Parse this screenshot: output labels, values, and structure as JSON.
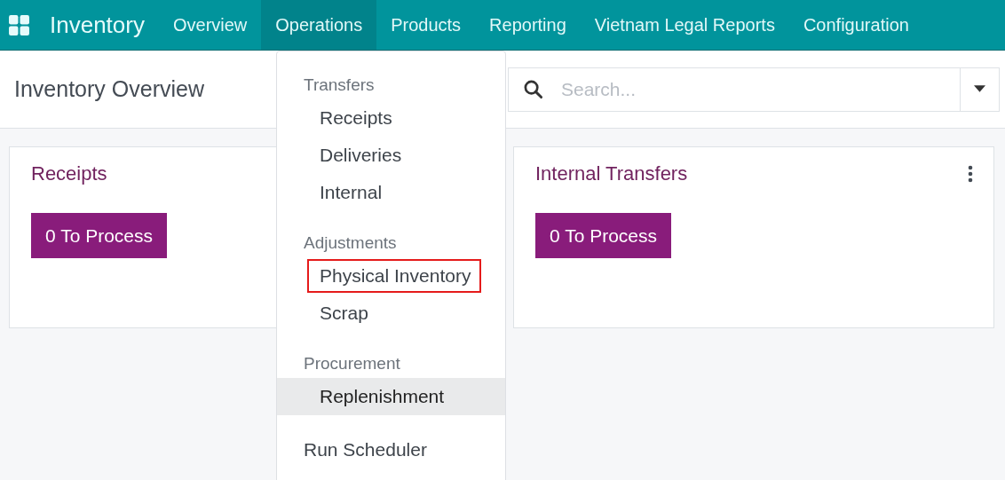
{
  "navbar": {
    "app_name": "Inventory",
    "items": [
      {
        "label": "Overview",
        "selected": false
      },
      {
        "label": "Operations",
        "selected": true
      },
      {
        "label": "Products",
        "selected": false
      },
      {
        "label": "Reporting",
        "selected": false
      },
      {
        "label": "Vietnam Legal Reports",
        "selected": false
      },
      {
        "label": "Configuration",
        "selected": false
      }
    ]
  },
  "page_title": "Inventory Overview",
  "search": {
    "placeholder": "Search..."
  },
  "cards": [
    {
      "title": "Receipts",
      "button": "0 To Process"
    },
    {
      "title": "Internal Transfers",
      "button": "0 To Process",
      "has_menu": true
    }
  ],
  "operations_menu": [
    {
      "kind": "header",
      "label": "Transfers"
    },
    {
      "kind": "sub",
      "label": "Receipts",
      "highlighted": false,
      "outlined": false
    },
    {
      "kind": "sub",
      "label": "Deliveries",
      "highlighted": false,
      "outlined": false
    },
    {
      "kind": "sub",
      "label": "Internal",
      "highlighted": false,
      "outlined": false
    },
    {
      "kind": "header",
      "label": "Adjustments"
    },
    {
      "kind": "sub",
      "label": "Physical Inventory",
      "highlighted": false,
      "outlined": true
    },
    {
      "kind": "sub",
      "label": "Scrap",
      "highlighted": false,
      "outlined": false
    },
    {
      "kind": "header",
      "label": "Procurement"
    },
    {
      "kind": "sub",
      "label": "Replenishment",
      "highlighted": true,
      "outlined": false
    },
    {
      "kind": "item",
      "label": "Run Scheduler",
      "highlighted": false,
      "outlined": false
    }
  ]
}
